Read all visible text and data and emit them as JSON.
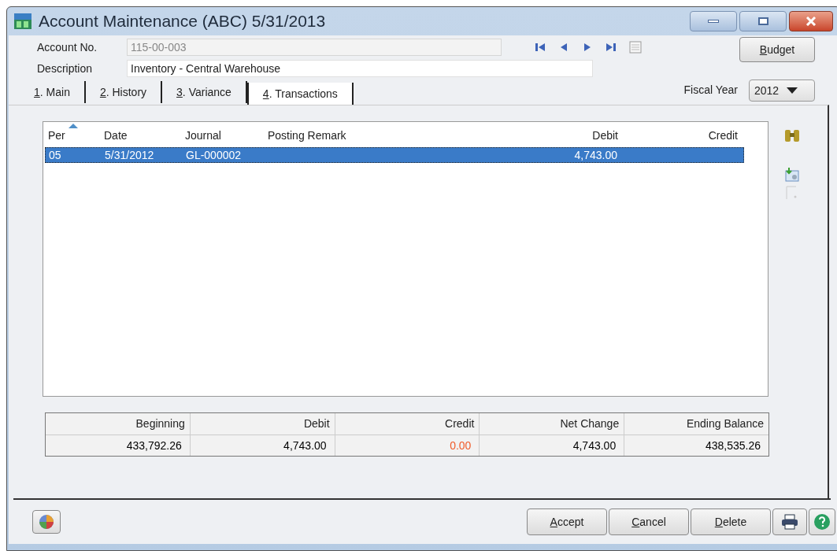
{
  "window": {
    "title": "Account Maintenance (ABC) 5/31/2013"
  },
  "header": {
    "account_label": "Account No.",
    "account_value": "115-00-003",
    "description_label": "Description",
    "description_value": "Inventory - Central Warehouse",
    "budget_button": {
      "label": "Budget"
    },
    "fiscal_year_label": "Fiscal Year",
    "fiscal_year_value": "2012"
  },
  "tabs": [
    {
      "label": "1. Main",
      "selected": false
    },
    {
      "label": "2. History",
      "selected": false
    },
    {
      "label": "3. Variance",
      "selected": false
    },
    {
      "label": "4. Transactions",
      "selected": true
    }
  ],
  "table": {
    "columns": [
      "Per",
      "Date",
      "Journal",
      "Posting Remark",
      "Debit",
      "Credit"
    ],
    "rows": [
      {
        "cells": [
          "05",
          "5/31/2012",
          "GL-000002",
          "",
          "4,743.00",
          ""
        ],
        "selected": true
      }
    ]
  },
  "totals": {
    "columns": [
      "Beginning",
      "Debit",
      "Credit",
      "Net Change",
      "Ending Balance"
    ],
    "values": [
      {
        "text": "433,792.26",
        "color": "#000000"
      },
      {
        "text": "4,743.00",
        "color": "#000000"
      },
      {
        "text": "0.00",
        "color": "#f05a28"
      },
      {
        "text": "4,743.00",
        "color": "#000000"
      },
      {
        "text": "438,535.26",
        "color": "#000000"
      }
    ]
  },
  "footer_buttons": [
    {
      "label": "Accept"
    },
    {
      "label": "Cancel"
    },
    {
      "label": "Delete"
    }
  ]
}
